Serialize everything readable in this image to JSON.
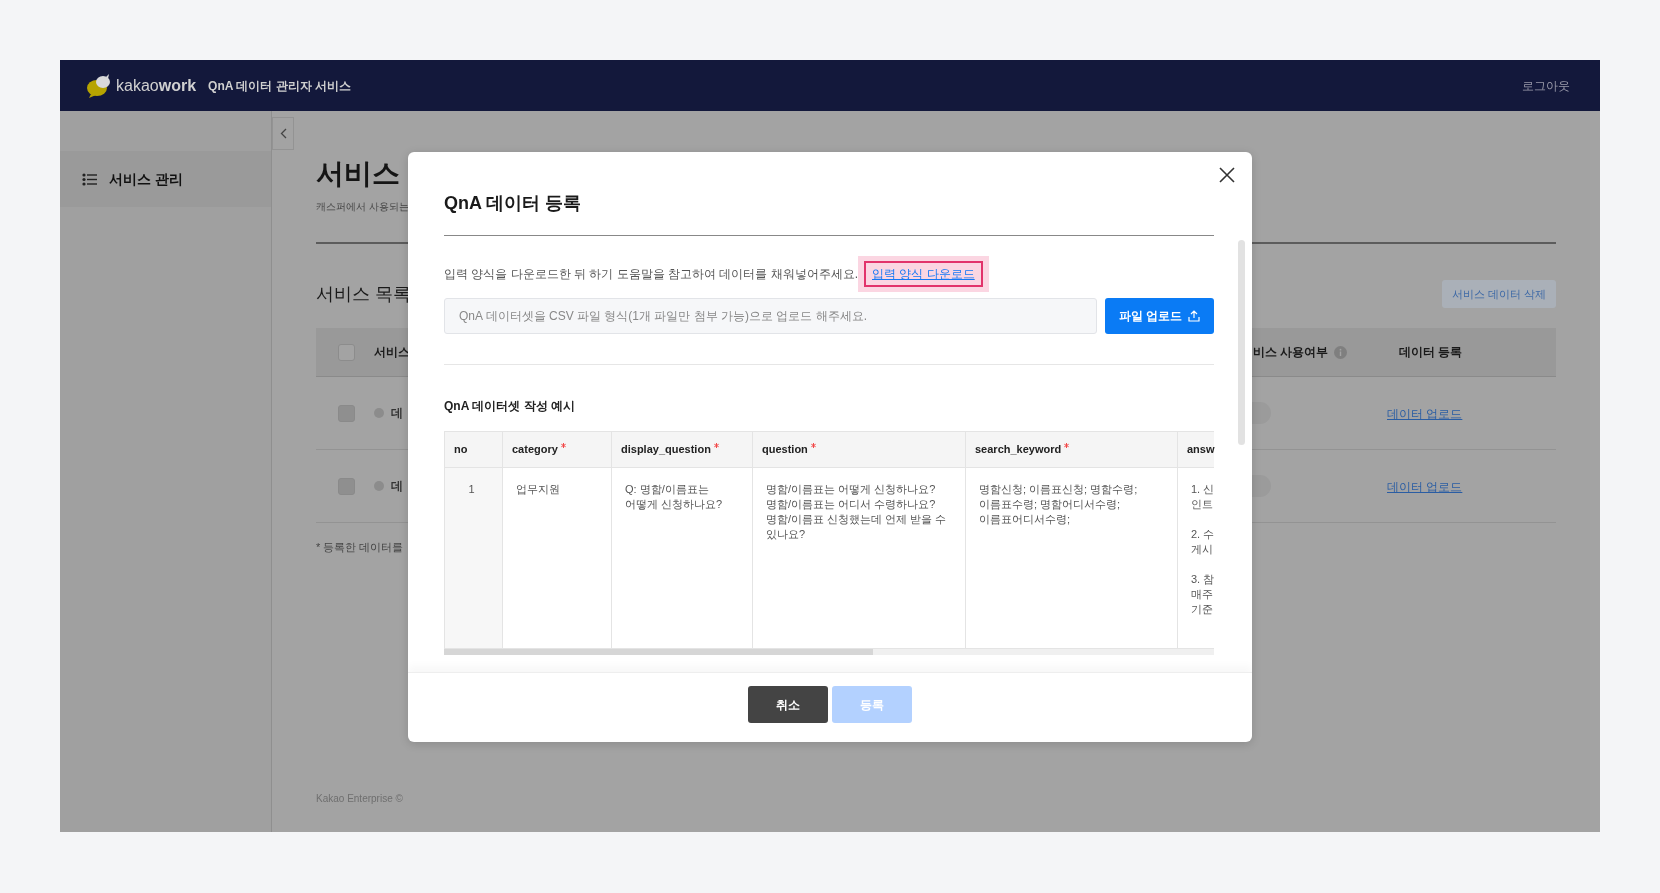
{
  "header": {
    "logo": "kakao**work**",
    "title": "QnA 데이터 관리자 서비스",
    "logout": "로그아웃"
  },
  "sidebar": {
    "items": [
      {
        "label": "서비스 관리",
        "selected": true
      }
    ]
  },
  "page": {
    "title": "서비스",
    "subtitle": "캐스퍼에서 사용되는",
    "list_title": "서비스 목록",
    "delete_button": "서비스 데이터 삭제",
    "table": {
      "checked": false,
      "columns": [
        "서비스",
        "비스 사용여부",
        "데이터 등록"
      ],
      "rows": [
        {
          "checked": false,
          "name": "데",
          "on": false,
          "link": "데이터 업로드"
        },
        {
          "checked": false,
          "name": "데",
          "on": false,
          "link": "데이터 업로드"
        }
      ]
    },
    "note": "* 등록한 데이터를",
    "footer": "Kakao Enterprise ©"
  },
  "modal": {
    "title": "QnA 데이터 등록",
    "description": "입력 양식을 다운로드한 뒤 하기 도움말을 참고하여 데이터를 채워넣어주세요.",
    "download_link": "입력 양식 다운로드",
    "upload_placeholder": "QnA 데이터셋을 CSV 파일 형식(1개 파일만 첨부 가능)으로 업로드 해주세요.",
    "upload_button": "파일 업로드",
    "example_title": "QnA 데이터셋 작성 예시",
    "example_table": {
      "columns": [
        {
          "label": "no",
          "required": false
        },
        {
          "label": "category",
          "required": true
        },
        {
          "label": "display_question",
          "required": true
        },
        {
          "label": "question",
          "required": true
        },
        {
          "label": "search_keyword",
          "required": true
        },
        {
          "label": "answ"
        }
      ],
      "rows": [
        {
          "cells": [
            [
              "1"
            ],
            [
              "업무지원"
            ],
            [
              "Q: 명함/이름표는",
              "어떻게 신청하나요?"
            ],
            [
              "명함/이름표는 어떻게 신청하나요?",
              "명함/이름표는 어디서 수령하나요?",
              "명함/이름표 신청했는데 언제 받을 수",
              "있나요?"
            ],
            [
              "명함신청; 이름표신청; 명함수령;",
              "이름표수령; 명함어디서수령;",
              "이름표어디서수령;"
            ],
            [
              "1. 신",
              "인트",
              "",
              "2. 수",
              "게시",
              "",
              "3. 참",
              "매주",
              "기준"
            ]
          ]
        }
      ]
    },
    "buttons": [
      {
        "label": "취소",
        "kind": "cancel",
        "disabled": false
      },
      {
        "label": "등록",
        "kind": "submit",
        "disabled": true
      }
    ]
  }
}
